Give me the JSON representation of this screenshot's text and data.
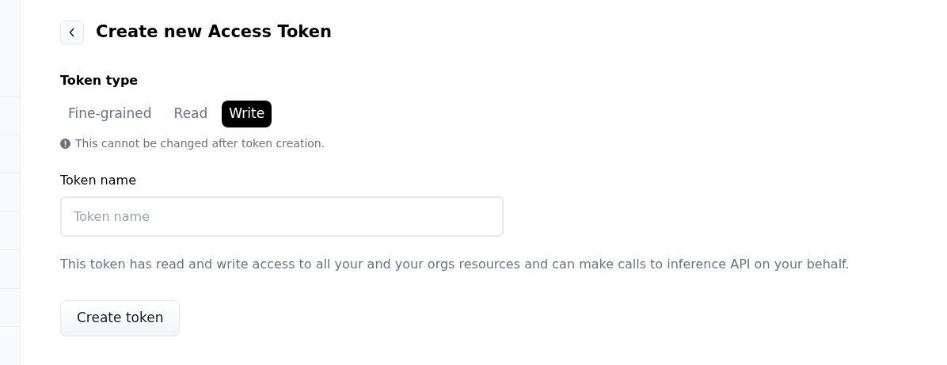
{
  "header": {
    "title": "Create new Access Token"
  },
  "token_type": {
    "label": "Token type",
    "options": [
      {
        "label": "Fine-grained",
        "selected": false
      },
      {
        "label": "Read",
        "selected": false
      },
      {
        "label": "Write",
        "selected": true
      }
    ],
    "note": "This cannot be changed after token creation."
  },
  "token_name": {
    "label": "Token name",
    "placeholder": "Token name"
  },
  "description": "This token has read and write access to all your and your orgs resources and can make calls to inference API on your behalf.",
  "submit": {
    "label": "Create token"
  }
}
